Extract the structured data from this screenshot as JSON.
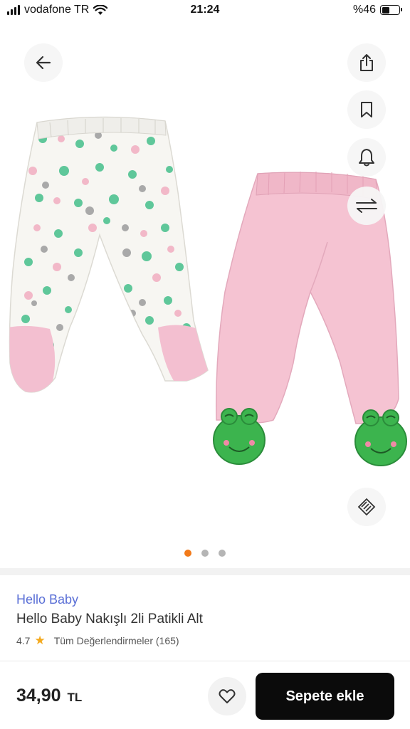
{
  "status_bar": {
    "carrier": "vodafone TR",
    "time": "21:24",
    "battery": "%46",
    "battery_level": 0.46
  },
  "gallery": {
    "image_count": 3,
    "active_index": 0,
    "accent_color": "#f27a1a",
    "icons": {
      "back": "arrow-left-icon",
      "share": "share-icon",
      "bookmark": "bookmark-icon",
      "bell": "bell-icon",
      "compare": "swap-arrows-icon",
      "size": "ruler-icon"
    }
  },
  "product": {
    "brand": "Hello Baby",
    "title": "Hello Baby Nakışlı 2li Patikli Alt",
    "rating": "4.7",
    "reviews_label": "Tüm Değerlendirmeler (165)",
    "brand_color": "#5a6fd6"
  },
  "bottom_bar": {
    "price": "34,90",
    "currency": "TL",
    "cart_label": "Sepete ekle"
  }
}
